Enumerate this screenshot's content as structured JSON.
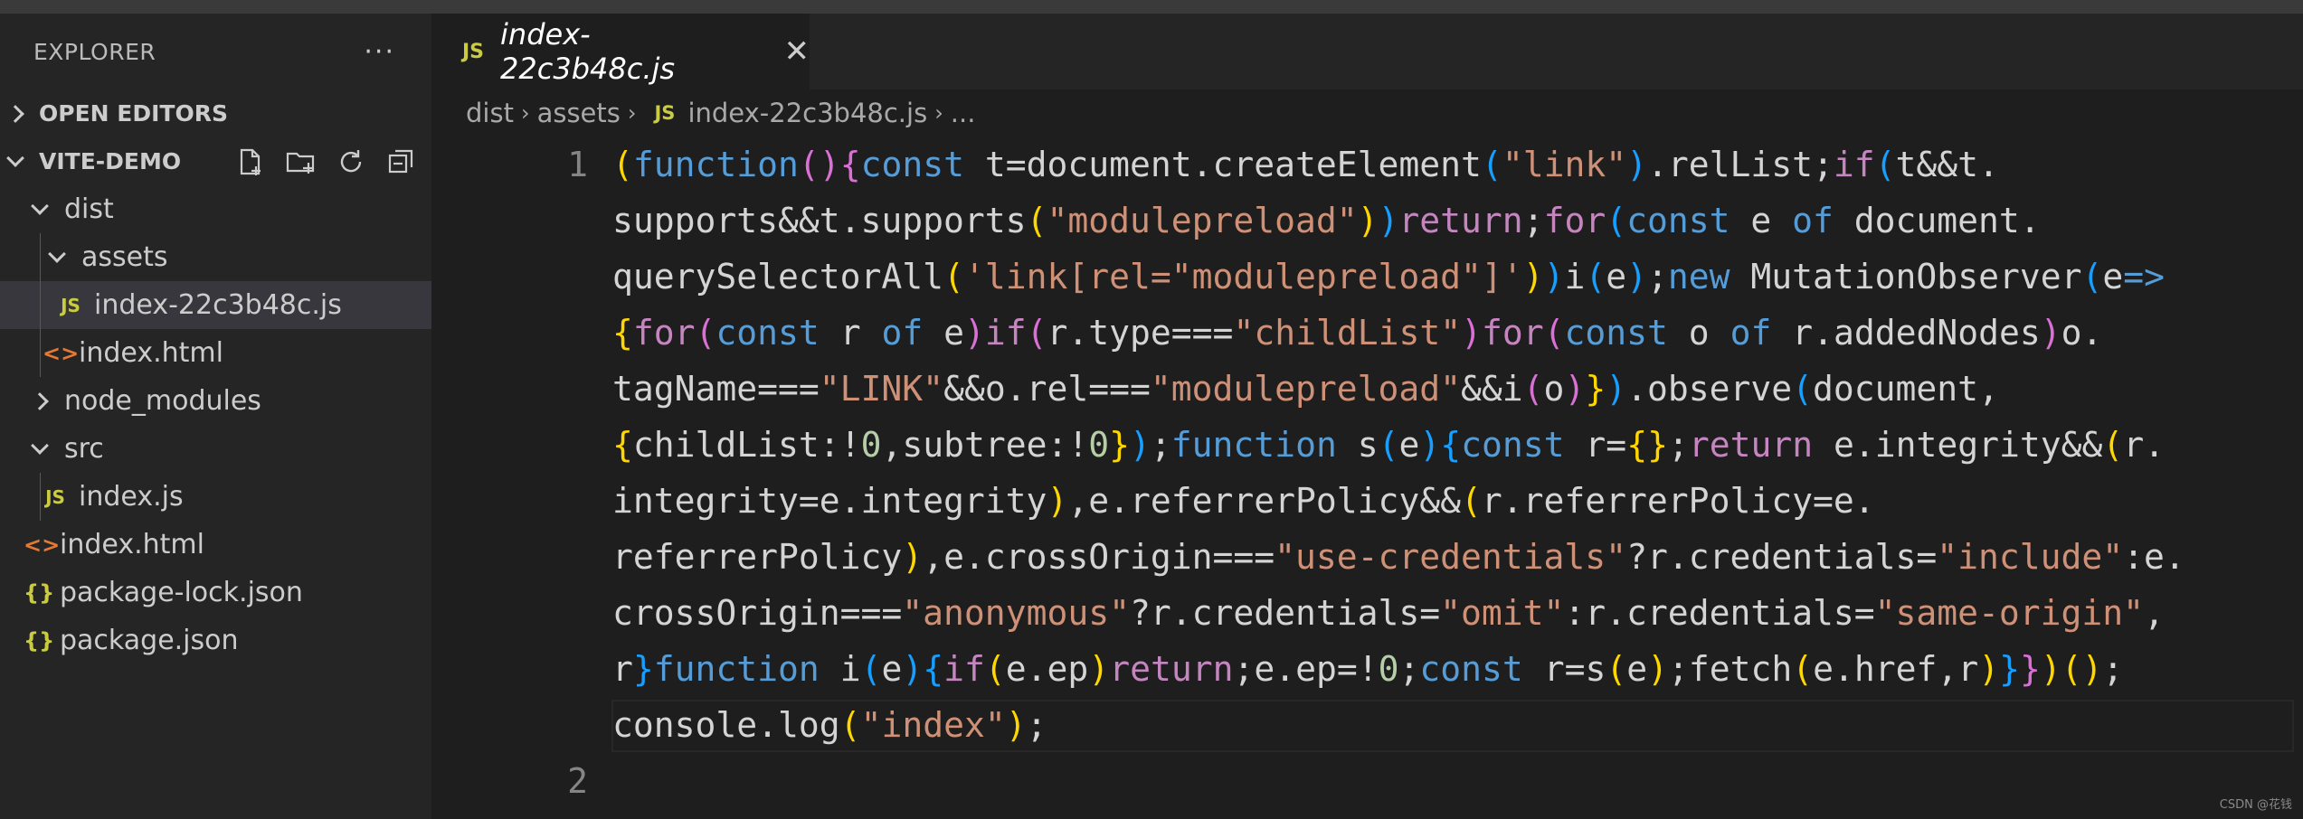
{
  "explorer": {
    "title": "EXPLORER",
    "more": "···",
    "open_editors": "OPEN EDITORS",
    "project": "VITE-DEMO",
    "tree": [
      {
        "label": "dist"
      },
      {
        "label": "assets"
      },
      {
        "label": "index-22c3b48c.js",
        "icon": "JS"
      },
      {
        "label": "index.html",
        "icon": "<>"
      },
      {
        "label": "node_modules"
      },
      {
        "label": "src"
      },
      {
        "label": "index.js",
        "icon": "JS"
      },
      {
        "label": "index.html",
        "icon": "<>"
      },
      {
        "label": "package-lock.json",
        "icon": "{}"
      },
      {
        "label": "package.json",
        "icon": "{}"
      }
    ]
  },
  "tab": {
    "icon": "JS",
    "name": "index-22c3b48c.js",
    "close": "✕"
  },
  "breadcrumb": {
    "part1": "dist",
    "part2": "assets",
    "icon": "JS",
    "part3": "index-22c3b48c.js",
    "part4": "..."
  },
  "line_numbers": [
    "1",
    "2"
  ],
  "watermark": "CSDN @花钱"
}
